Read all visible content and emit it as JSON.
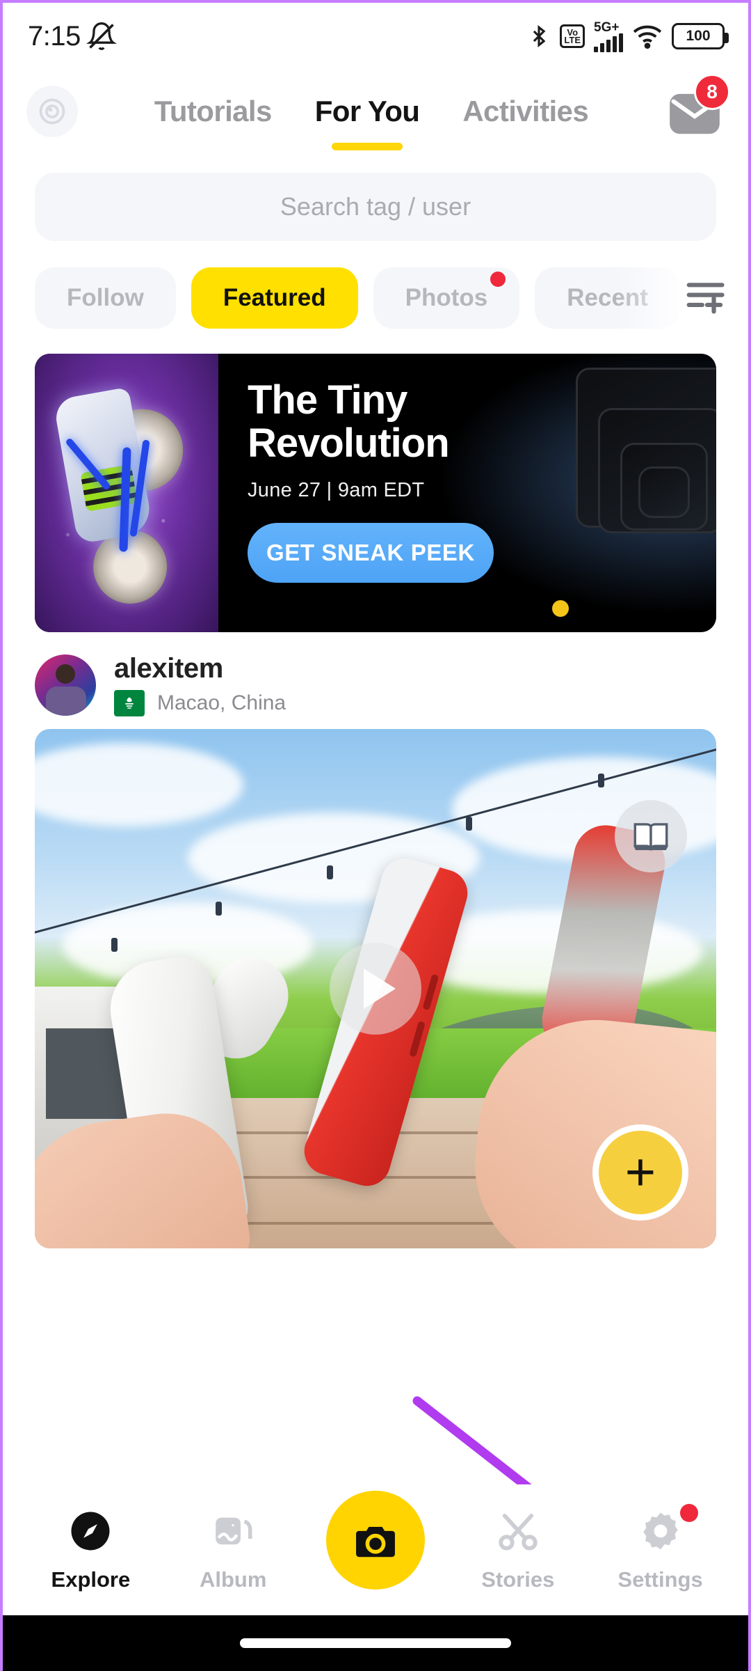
{
  "status_bar": {
    "time": "7:15",
    "icons": [
      "mute-bell-icon",
      "bluetooth-icon",
      "volte-icon",
      "5g-plus-icon",
      "signal-bars-icon",
      "wifi-icon",
      "battery-icon"
    ],
    "volte_top": "Vo",
    "volte_bottom": "LTE",
    "network": "5G+",
    "battery_level": "100"
  },
  "top_nav": {
    "lens_icon": "lens-camera-icon",
    "tabs": [
      {
        "label": "Tutorials",
        "active": false
      },
      {
        "label": "For You",
        "active": true
      },
      {
        "label": "Activities",
        "active": false
      }
    ],
    "inbox_icon": "inbox-mail-icon",
    "inbox_badge": "8"
  },
  "search": {
    "placeholder": "Search tag / user",
    "value": ""
  },
  "chips": {
    "items": [
      {
        "label": "Follow",
        "active": false,
        "dot": false
      },
      {
        "label": "Featured",
        "active": true,
        "dot": false
      },
      {
        "label": "Photos",
        "active": false,
        "dot": true
      },
      {
        "label": "Recent",
        "active": false,
        "dot": false
      }
    ],
    "filter_icon": "list-add-filter-icon"
  },
  "banner": {
    "title_line1": "The Tiny",
    "title_line2": "Revolution",
    "date_time": "June 27  |  9am EDT",
    "cta_label": "GET SNEAK PEEK",
    "indicator": "carousel-dot",
    "accent_blue": "#4ea3f5",
    "accent_yellow": "#F5C518"
  },
  "post": {
    "avatar": "user-avatar",
    "username": "alexitem",
    "location_badge": "macao-flag-icon",
    "location": "Macao, China",
    "media": {
      "type": "video",
      "play_icon": "play-icon",
      "book_icon": "book-icon",
      "add_icon": "plus-icon"
    }
  },
  "bottom_nav": {
    "items": [
      {
        "label": "Explore",
        "icon": "compass-icon",
        "active": true,
        "dot": false
      },
      {
        "label": "Album",
        "icon": "photos-icon",
        "active": false,
        "dot": false
      },
      {
        "label": "",
        "icon": "camera-icon",
        "active": false,
        "dot": false
      },
      {
        "label": "Stories",
        "icon": "scissors-icon",
        "active": false,
        "dot": false
      },
      {
        "label": "Settings",
        "icon": "gear-icon",
        "active": false,
        "dot": true
      }
    ]
  },
  "annotation": {
    "arrow": "purple-arrow-pointing-to-settings",
    "color": "#B13BEF"
  },
  "theme": {
    "brand_yellow": "#FFD400",
    "chip_yellow": "#FFE000",
    "badge_red": "#EF2B3B",
    "text_dark": "#141414",
    "text_muted": "#b8b9bf",
    "surface": "#f5f6fa"
  }
}
